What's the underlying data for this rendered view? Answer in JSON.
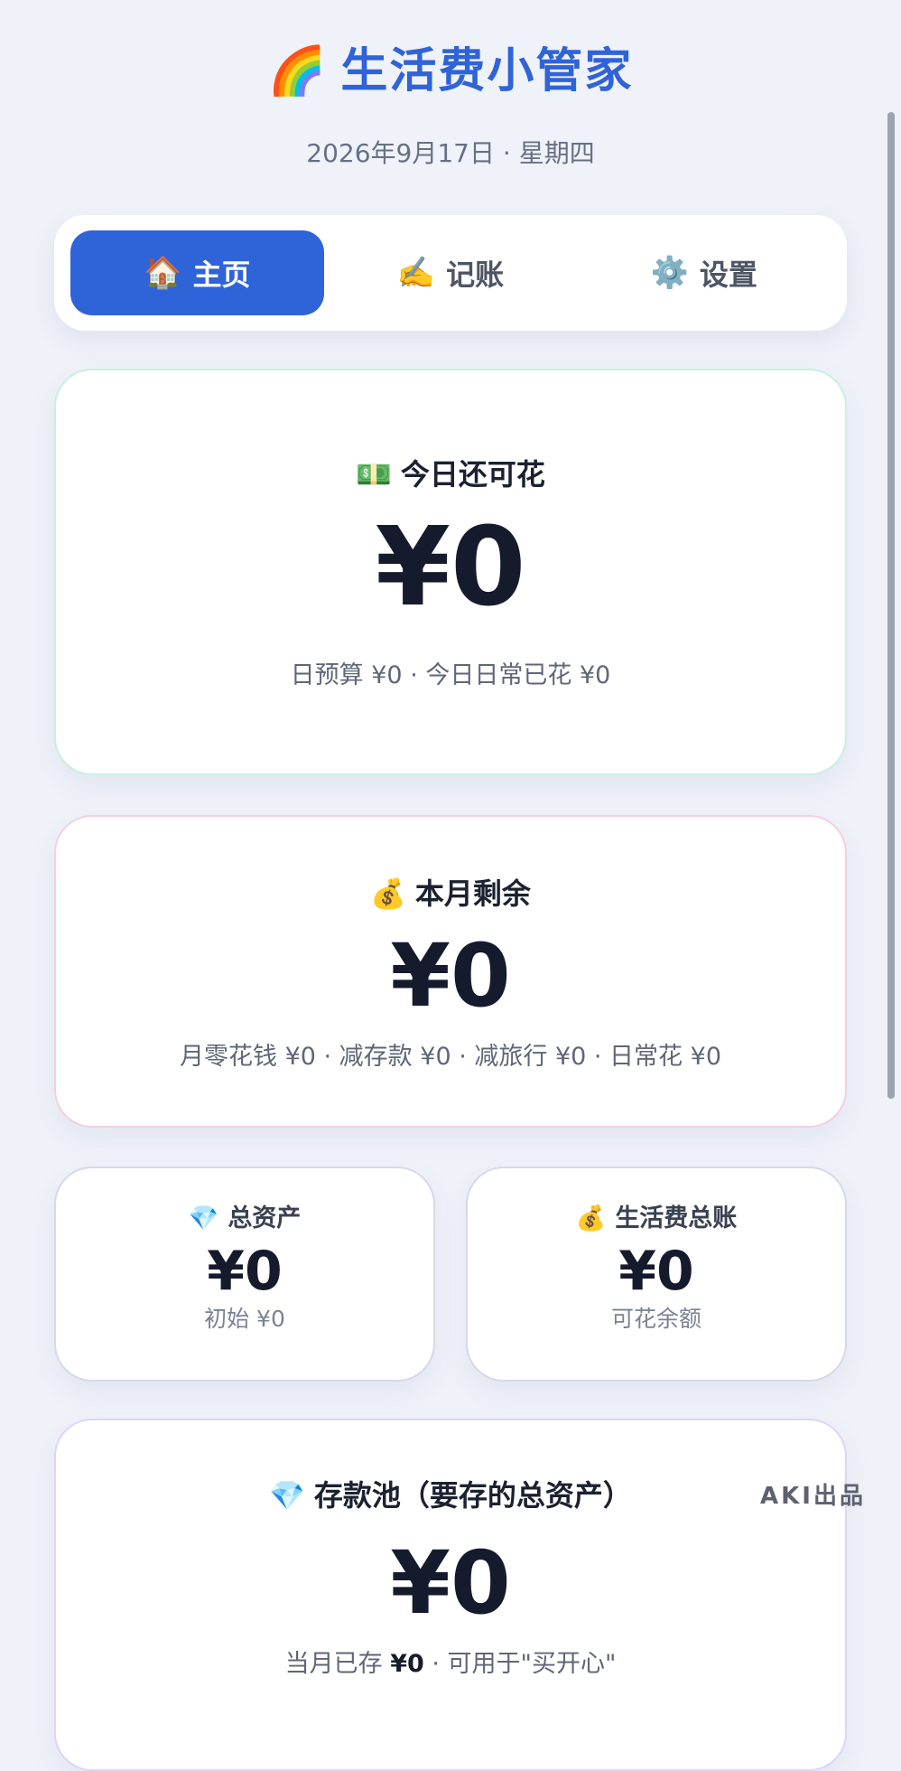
{
  "header": {
    "title_emoji": "🌈",
    "title": "生活费小管家",
    "date": "2026年9月17日 · 星期四"
  },
  "tabs": [
    {
      "emoji": "🏠",
      "label": "主页",
      "active": true
    },
    {
      "emoji": "✍️",
      "label": "记账",
      "active": false
    },
    {
      "emoji": "⚙️",
      "label": "设置",
      "active": false
    }
  ],
  "today_card": {
    "emoji": "💵",
    "label": "今日还可花",
    "amount": "¥0",
    "sub": "日预算 ¥0 · 今日日常已花 ¥0"
  },
  "month_card": {
    "emoji": "💰",
    "label": "本月剩余",
    "amount": "¥0",
    "sub": "月零花钱 ¥0 · 减存款 ¥0 · 减旅行 ¥0 · 日常花 ¥0"
  },
  "assets_card": {
    "emoji": "💎",
    "label": "总资产",
    "amount": "¥0",
    "sub": "初始 ¥0"
  },
  "living_card": {
    "emoji": "💰",
    "label": "生活费总账",
    "amount": "¥0",
    "sub": "可花余额"
  },
  "savings_card": {
    "emoji": "💎",
    "label": "存款池（要存的总资产）",
    "amount": "¥0",
    "sub_prefix": "当月已存 ",
    "sub_value": "¥0",
    "sub_suffix": " · 可用于\"买开心\""
  },
  "credit": "AKI出品",
  "colors": {
    "accent": "#2f63d8",
    "background": "#eff2f8",
    "today_border": "#c9efe0",
    "month_border": "#f6cfe1",
    "savings_border": "#e0d4f7"
  }
}
